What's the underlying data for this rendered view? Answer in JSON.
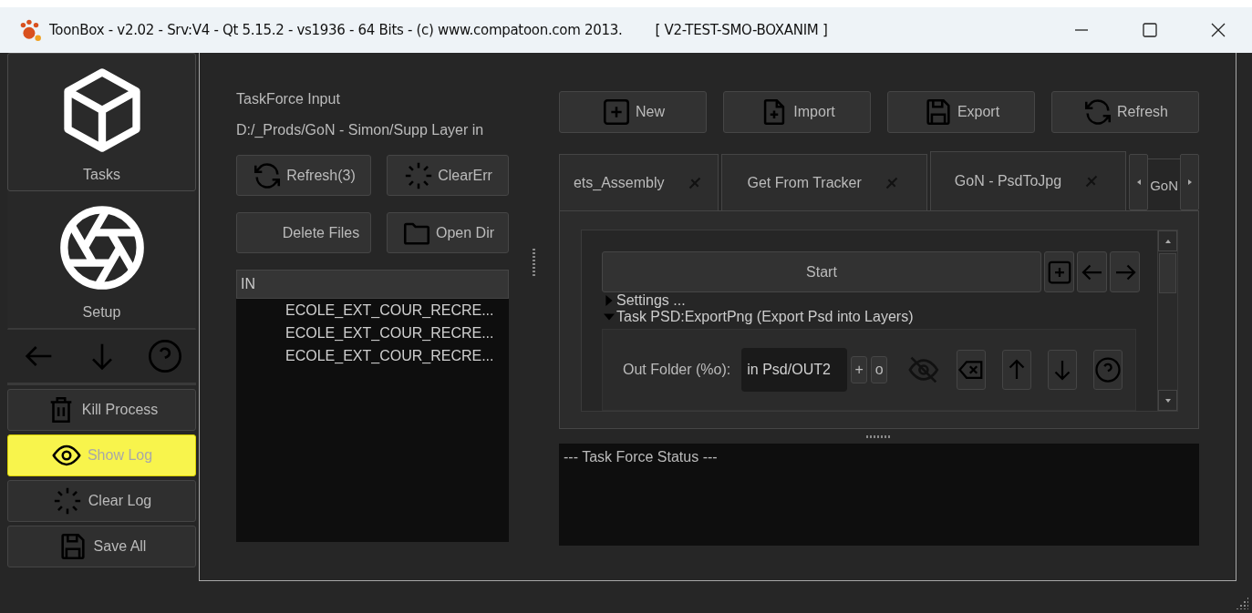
{
  "window": {
    "title": "ToonBox - v2.02 - Srv:V4 - Qt 5.15.2 - vs1936 - 64 Bits - (c) www.compatoon.com 2013.",
    "tag": "[ V2-TEST-SMO-BOXANIM ]"
  },
  "sidebar": {
    "modes": [
      {
        "label": "Tasks",
        "selected": true
      },
      {
        "label": "Setup",
        "selected": false
      }
    ],
    "actions": [
      {
        "label": "Kill Process",
        "on": false
      },
      {
        "label": "Show Log",
        "on": true
      },
      {
        "label": "Clear Log",
        "on": false
      },
      {
        "label": "Save All",
        "on": false
      }
    ]
  },
  "input": {
    "title": "TaskForce Input",
    "path": "D:/_Prods/GoN - Simon/Supp Layer in",
    "buttons": [
      "Refresh(3)",
      "ClearErr",
      "Delete Files",
      "Open Dir"
    ],
    "list": {
      "header": "IN",
      "items": [
        "ECOLE_EXT_COUR_RECRE...",
        "ECOLE_EXT_COUR_RECRE...",
        "ECOLE_EXT_COUR_RECRE..."
      ]
    }
  },
  "toolbar": [
    "New",
    "Import",
    "Export",
    "Refresh"
  ],
  "tabs": [
    {
      "label": "ets_Assembly",
      "selected": false
    },
    {
      "label": "Get From Tracker",
      "selected": false
    },
    {
      "label": "GoN - PsdToJpg",
      "selected": true
    },
    {
      "label": "GoN",
      "selected": false
    }
  ],
  "task": {
    "start": "Start",
    "sections": [
      {
        "label": "Settings ...",
        "expanded": false
      },
      {
        "label": "Task PSD:ExportPng (Export Psd into Layers)",
        "expanded": true,
        "fields": [
          {
            "label": "Out Folder (%o):",
            "value": "in Psd/OUT2",
            "buttons": [
              "+",
              "o"
            ]
          }
        ]
      }
    ]
  },
  "status": {
    "text": "--- Task Force Status ---"
  }
}
